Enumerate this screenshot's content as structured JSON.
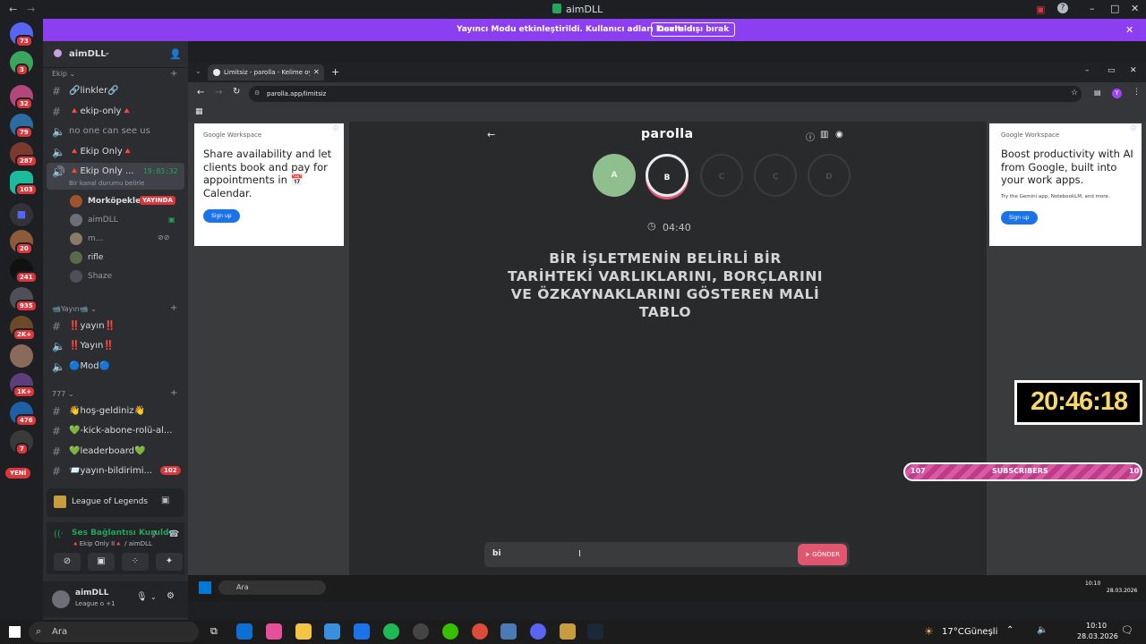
{
  "titlebar": {
    "title": "aimDLL"
  },
  "banner": {
    "message": "Yayıncı Modu etkinleştirildi. Kullanıcı adları kısaltıldı.",
    "button": "Devre dışı bırak"
  },
  "guilds": {
    "badges": [
      "73",
      "3",
      "32",
      "79",
      "287",
      "103",
      "20",
      "241",
      "935",
      "2K+",
      "1K+",
      "476",
      "7"
    ],
    "new_label": "YENİ"
  },
  "server": {
    "name": "aimDLL",
    "category_ekip": "Ekip",
    "category_yayin": "Yayın",
    "category_777": "777"
  },
  "channels": [
    {
      "label": "🔗linkler🔗"
    },
    {
      "label": "🔺ekip-only🔺"
    },
    {
      "label": "no one can see us"
    },
    {
      "label": "🔺Ekip Only🔺"
    },
    {
      "label": "🔺Ekip Only ..."
    },
    {
      "label": "‼️yayın‼️"
    },
    {
      "label": "‼️Yayın‼️"
    },
    {
      "label": "🔵Mod🔵"
    },
    {
      "label": "👋hoş-geldiniz👋"
    },
    {
      "label": "💚-kick-abone-rolü-al..."
    },
    {
      "label": "💚leaderboard💚"
    },
    {
      "label": "📨yayın-bildirimi..."
    }
  ],
  "voice": {
    "timer": "19:03:32",
    "status_sub": "Bir kanal durumu belirle",
    "live_badge": "YAYINDA",
    "unread": "102"
  },
  "voice_users": [
    "Morköpekler",
    "aimDLL",
    "m...",
    "rifle",
    "Shaze"
  ],
  "activity": {
    "game": "League of Legends"
  },
  "connection": {
    "title": "Ses Bağlantısı Kuruldu",
    "sub": "🔺Ekip Only II🔺 / aimDLL"
  },
  "self": {
    "name": "aimDLL",
    "status": "League o +1"
  },
  "browser": {
    "tab_title": "Limitsiz - parolla - Kelime oyun",
    "url": "parolla.app/limitsiz",
    "profile": "Y"
  },
  "ad_left": {
    "brand": "Google Workspace",
    "headline": "Share availability and let clients book and pay for appointments in 📅Calendar.",
    "cta": "Sign up"
  },
  "ad_right": {
    "brand": "Google Workspace",
    "headline": "Boost productivity with AI from Google, built into your work apps.",
    "sub": "Try the Gemini app, NotebookLM, and more.",
    "cta": "Sign up"
  },
  "game": {
    "logo": "parolla",
    "letters": [
      "A",
      "B",
      "C",
      "Ç",
      "D"
    ],
    "timer": "04:40",
    "question": "BİR İŞLETMENİN BELİRLİ BİR TARİHTEKİ VARLIKLARINI, BORÇLARINI VE ÖZKAYNAKLARINI GÖSTEREN MALİ TABLO",
    "answer": "bi",
    "submit": "GÖNDER"
  },
  "overlay": {
    "clock": "20:46:18",
    "sub_left": "107",
    "sub_label": "SUBSCRIBERS",
    "sub_right": "10"
  },
  "inner_taskbar": {
    "search": "Ara",
    "time": "10:10",
    "date": "28.03.2026"
  },
  "taskbar": {
    "search": "Ara",
    "weather": "17°C",
    "weather_label": "Güneşli",
    "time": "10:10",
    "date": "28.03.2026"
  }
}
